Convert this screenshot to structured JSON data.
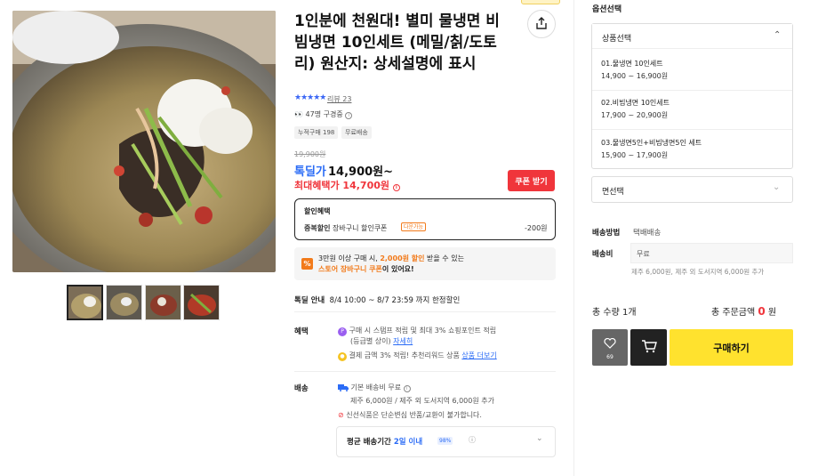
{
  "product": {
    "title": "1인분에 천원대! 별미 물냉면 비빔냉면 10인세트 (메밀/칡/도토리) 원산지: 상세설명에 표시",
    "stars": "★★★★★",
    "review": "리뷰 23",
    "viewers": "47명 구경중",
    "chips": [
      "누적구매 198",
      "무료배송"
    ],
    "thumbnail_count": 4
  },
  "price": {
    "original": "19,900원",
    "deal_label": "톡딜가",
    "deal_price": "14,900원~",
    "max_benefit": "최대혜택가 14,700원",
    "coupon_button": "쿠폰 받기"
  },
  "benefit_box": {
    "title": "할인혜택",
    "row_label": "중복할인",
    "row_desc": "장바구니 할인쿠폰",
    "row_badge": "다운가능",
    "row_amount": "-200원"
  },
  "promo": {
    "icon": "%",
    "line1_pre": "3만원 이상 구매 시, ",
    "line1_highlight": "2,000원 할인",
    "line1_post": " 받을 수 있는",
    "line2_highlight": "스토어 장바구니 쿠폰",
    "line2_post": "이 있어요!"
  },
  "deal_guide": {
    "label": "톡딜 안내",
    "text": "8/4 10:00 ~ 8/7 23:59 까지 한정할인"
  },
  "benefits": {
    "label": "혜택",
    "line1": "구매 시 스탬프 적립 및 최대 3% 쇼핑포인트 적립",
    "line2_pre": "(등급별 상이) ",
    "line2_link": "자세히",
    "line3_pre": "결제 금액 3% 적립! 추천리워드 상품 ",
    "line3_link": "상품 더보기"
  },
  "shipping": {
    "label": "배송",
    "line1": "기본 배송비 무료",
    "line2": "제주 6,000원 / 제주 외 도서지역 6,000원 추가",
    "line3": "신선식품은 단순변심 반품/교환이 불가합니다.",
    "avg_pre": "평균 배송기간 ",
    "avg_days": "2일 이내",
    "avg_badge": "98%"
  },
  "options": {
    "section_title": "옵션선택",
    "product_select": "상품선택",
    "items": [
      {
        "name": "01.물냉면 10인세트",
        "price": "14,900 ~ 16,900원"
      },
      {
        "name": "02.비빔냉면 10인세트",
        "price": "17,900 ~ 20,900원"
      },
      {
        "name": "03.물냉면5인+비빔냉면5인 세트",
        "price": "15,900 ~ 17,900원"
      }
    ],
    "noodle_select": "면선택"
  },
  "delivery_info": {
    "method_label": "배송방법",
    "method_value": "택배배송",
    "fee_label": "배송비",
    "fee_value": "무료",
    "fee_note": "제주 6,000원, 제주 외 도서지역 6,000원 추가"
  },
  "summary": {
    "qty": "총 수량 1개",
    "total_label": "총 주문금액 ",
    "total_value": "0",
    "total_unit": " 원"
  },
  "actions": {
    "wish_count": "69",
    "buy": "구매하기"
  },
  "colors": {
    "accent_blue": "#2b6cf6",
    "accent_red": "#f0353b",
    "accent_orange": "#f27a1a",
    "buy_yellow": "#ffe22e"
  }
}
